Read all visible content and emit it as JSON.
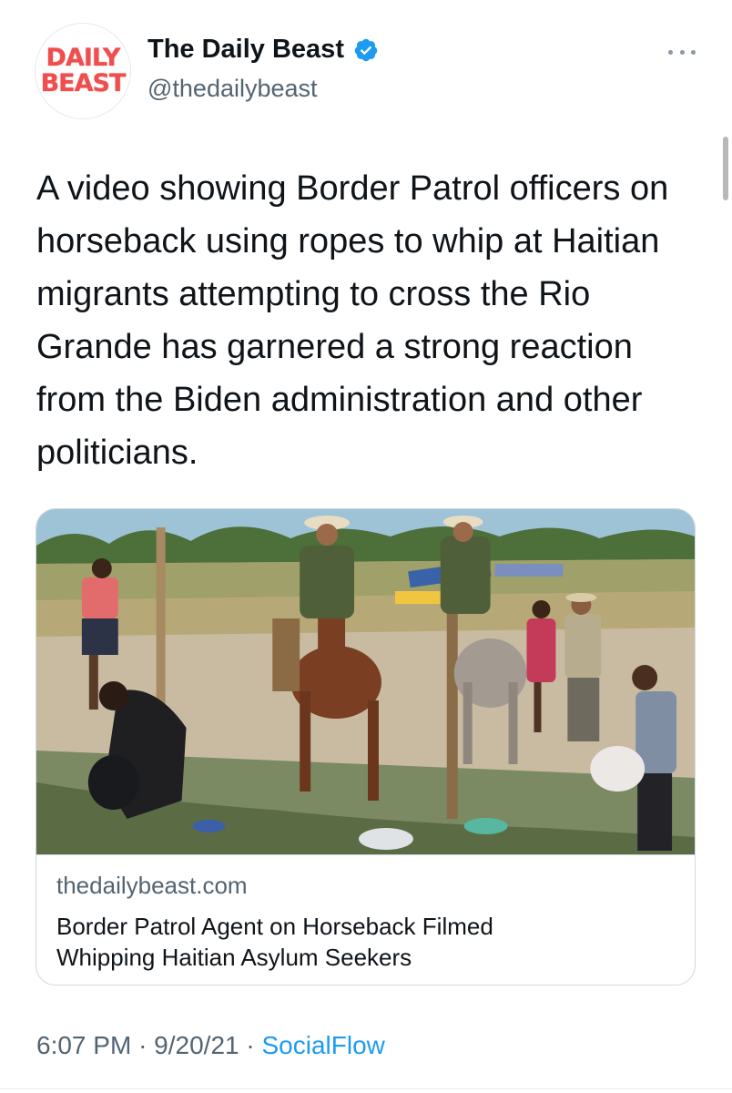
{
  "account": {
    "logo_line1": "DAILY",
    "logo_line2": "BEAST",
    "display_name": "The Daily Beast",
    "handle": "@thedailybeast",
    "verified": true
  },
  "tweet": {
    "text": "A video showing Border Patrol officers on horseback using ropes to whip at Haitian migrants attempting to cross the Rio Grande has garnered a strong reaction from the Biden administration and other politicians."
  },
  "card": {
    "domain": "thedailybeast.com",
    "title_line1": "Border Patrol Agent on Horseback Filmed",
    "title_line2": "Whipping Haitian Asylum Seekers"
  },
  "footer": {
    "time": "6:07 PM",
    "date": "9/20/21",
    "separator": "·",
    "source": "SocialFlow"
  },
  "colors": {
    "text": "#0f1419",
    "secondary": "#536471",
    "link": "#1d9bf0",
    "logo_red": "#ef4e4e"
  }
}
